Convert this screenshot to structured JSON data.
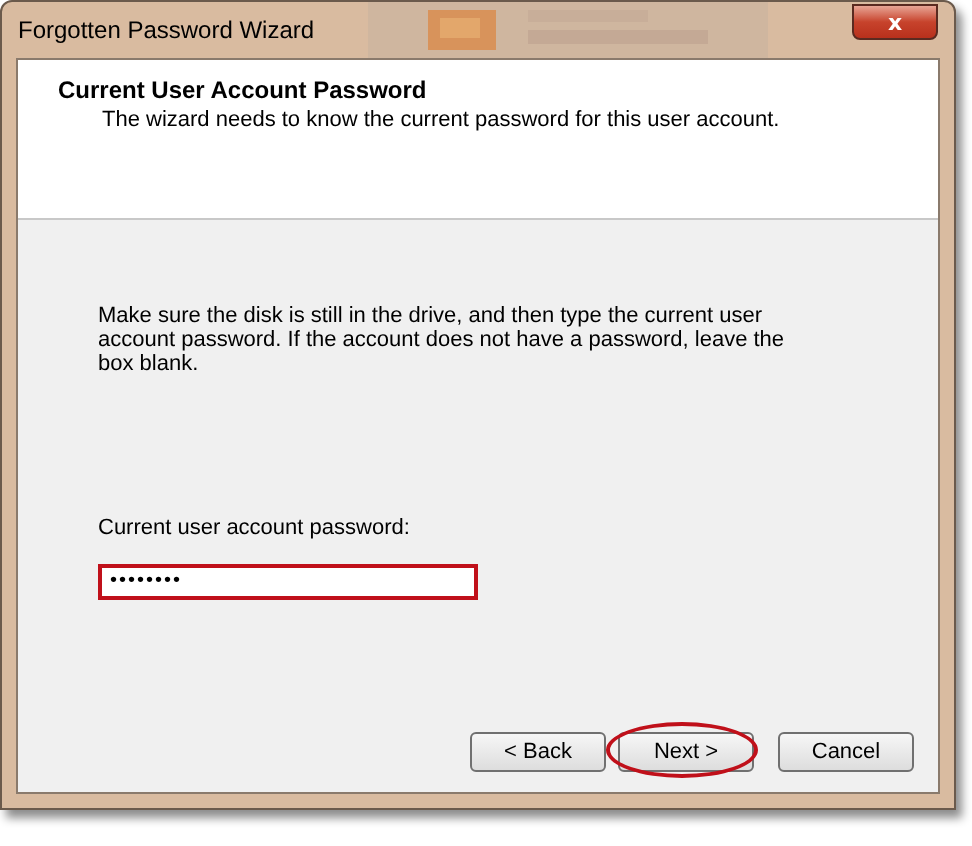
{
  "window": {
    "title": "Forgotten Password Wizard",
    "close": "x"
  },
  "header": {
    "title": "Current User Account Password",
    "subtitle": "The wizard needs to know the current password for this user account."
  },
  "instructions": "Make sure the disk is still in the drive, and then type the current user account password. If the account does not have a password, leave the box blank.",
  "password_field": {
    "label": "Current user account password:",
    "value": "••••••••",
    "highlighted": true
  },
  "buttons": [
    {
      "label": "< Back",
      "highlighted": false
    },
    {
      "label": "Next >",
      "highlighted": true
    },
    {
      "label": "Cancel",
      "highlighted": false
    }
  ]
}
